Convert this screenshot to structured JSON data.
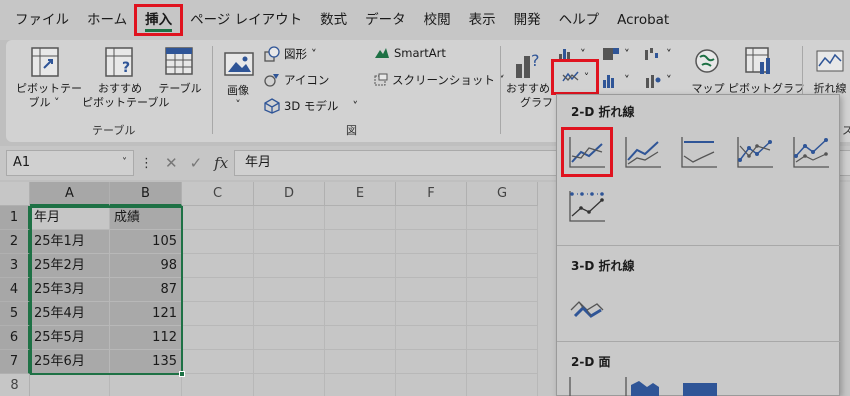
{
  "menu": {
    "tabs": [
      "ファイル",
      "ホーム",
      "挿入",
      "ページ レイアウト",
      "数式",
      "データ",
      "校閲",
      "表示",
      "開発",
      "ヘルプ",
      "Acrobat"
    ],
    "active_tab": "挿入"
  },
  "ribbon": {
    "pivot_table": [
      "ピボットテー",
      "ブル ˅"
    ],
    "recommended_pivot": [
      "おすすめ",
      "ピボットテーブル"
    ],
    "table": "テーブル",
    "tables_group": "テーブル",
    "image": "画像",
    "image_caret": "˅",
    "shapes": "図形",
    "icons": "アイコン",
    "model_3d": "3D モデル",
    "smartart": "SmartArt",
    "screenshot": "スクリーンショット",
    "illustrations_group": "図",
    "recommended_chart": [
      "おすすめ",
      "グラフ"
    ],
    "map": "マップ",
    "pivot_chart": "ピボットグラフ",
    "sparkline_line": "折れ線",
    "sparkline_peek": "ス"
  },
  "formula_bar": {
    "name_box": "A1",
    "formula": "年月"
  },
  "sheet": {
    "columns": [
      "A",
      "B",
      "C",
      "D",
      "E",
      "F",
      "G"
    ],
    "rows": [
      "1",
      "2",
      "3",
      "4",
      "5",
      "6",
      "7",
      "8"
    ],
    "data": [
      [
        "年月",
        "成績"
      ],
      [
        "25年1月",
        "105"
      ],
      [
        "25年2月",
        "98"
      ],
      [
        "25年3月",
        "87"
      ],
      [
        "25年4月",
        "121"
      ],
      [
        "25年5月",
        "112"
      ],
      [
        "25年6月",
        "135"
      ]
    ]
  },
  "gallery": {
    "section_2d_line": "2-D 折れ線",
    "section_3d_line": "3-D 折れ線",
    "section_2d_area": "2-D 面"
  },
  "colors": {
    "highlight": "#e0131f",
    "excel_green": "#1e7145",
    "chart_blue": "#2f5597"
  }
}
